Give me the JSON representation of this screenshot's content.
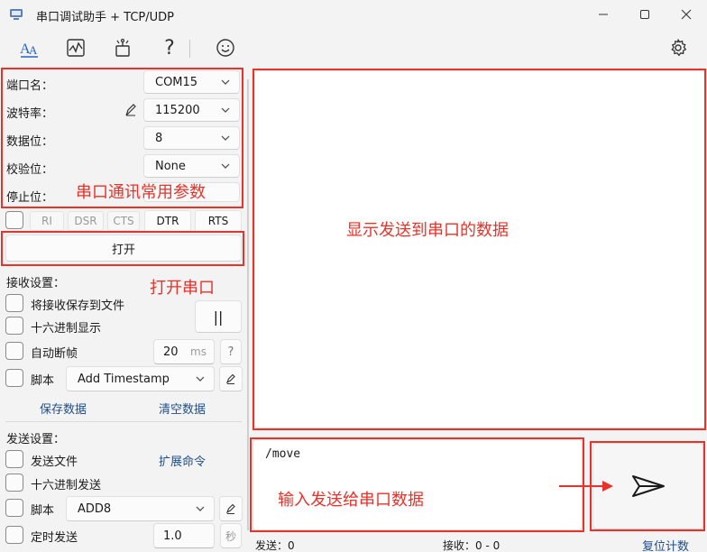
{
  "window": {
    "title": "串口调试助手 + TCP/UDP",
    "minimize_icon": "minimize-icon",
    "maximize_icon": "maximize-icon",
    "close_icon": "close-icon"
  },
  "toolbar": {
    "icons": [
      "font-aa-icon",
      "chart-icon",
      "plugin-icon",
      "help-icon",
      "smiley-icon",
      "gear-icon"
    ],
    "help_glyph": "?"
  },
  "serial": {
    "port_label": "端口名：",
    "port_value": "COM15",
    "baud_label": "波特率：",
    "baud_value": "115200",
    "databits_label": "数据位：",
    "databits_value": "8",
    "parity_label": "校验位：",
    "parity_value": "None",
    "stopbits_label": "停止位：",
    "pins": [
      "RI",
      "DSR",
      "CTS",
      "DTR",
      "RTS"
    ],
    "open_button": "打开"
  },
  "receive": {
    "title": "接收设置：",
    "save_to_file": "将接收保存到文件",
    "hex_display": "十六进制显示",
    "auto_frame": "自动断帧",
    "frame_ms_value": "20",
    "frame_ms_unit": "ms",
    "frame_help": "?",
    "pause_glyph": "||",
    "script_label": "脚本",
    "script_value": "Add Timestamp",
    "save_data": "保存数据",
    "clear_data": "清空数据"
  },
  "send": {
    "title": "发送设置：",
    "send_file": "发送文件",
    "ext_command": "扩展命令",
    "hex_send": "十六进制发送",
    "script_label": "脚本",
    "script_value": "ADD8",
    "timed_send": "定时发送",
    "interval_value": "1.0",
    "interval_unit": "秒",
    "input_text": "/move"
  },
  "status": {
    "sent": "发送：0",
    "received": "接收：0 - 0",
    "reset": "复位计数"
  },
  "annotations": {
    "serial_params": "串口通讯常用参数",
    "open_port": "打开串口",
    "display_sent": "显示发送到串口的数据",
    "input_send": "输入发送给串口数据"
  },
  "colors": {
    "annotation_red": "#e8322a",
    "link_blue": "#1f4e8c",
    "window_bg": "#f3f3f3"
  }
}
